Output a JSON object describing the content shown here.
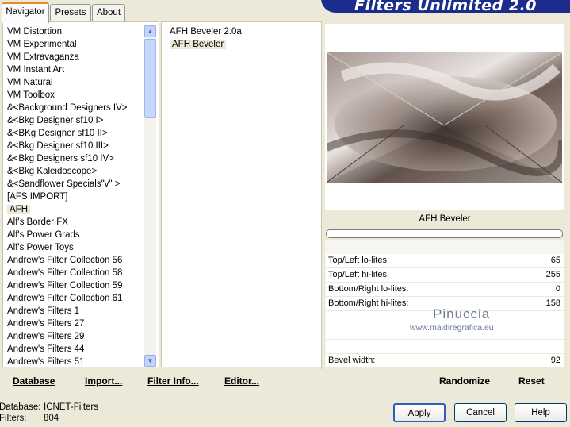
{
  "tabs": [
    {
      "label": "Navigator"
    },
    {
      "label": "Presets"
    },
    {
      "label": "About"
    }
  ],
  "banner": {
    "title": "Filters Unlimited 2.0"
  },
  "categories": [
    "VM Distortion",
    "VM Experimental",
    "VM Extravaganza",
    "VM Instant Art",
    "VM Natural",
    "VM Toolbox",
    "&<Background Designers IV>",
    "&<Bkg Designer sf10 I>",
    "&<BKg Designer sf10 II>",
    "&<Bkg Designer sf10 III>",
    "&<Bkg Designers sf10 IV>",
    "&<Bkg Kaleidoscope>",
    "&<Sandflower Specials\"v\" >",
    "[AFS IMPORT]",
    "AFH",
    "Alf's Border FX",
    "Alf's Power Grads",
    "Alf's Power Toys",
    "Andrew's Filter Collection 56",
    "Andrew's Filter Collection 58",
    "Andrew's Filter Collection 59",
    "Andrew's Filter Collection 61",
    "Andrew's Filters 1",
    "Andrew's Filters 27",
    "Andrew's Filters 29",
    "Andrew's Filters 44",
    "Andrew's Filters 51"
  ],
  "selected_category": "AFH",
  "filters": [
    "AFH Beveler 2.0a",
    "AFH Beveler"
  ],
  "selected_filter": "AFH Beveler",
  "bottom_buttons": {
    "database": "Database",
    "import": "Import...",
    "filter_info": "Filter Info...",
    "editor": "Editor..."
  },
  "filter_name": "AFH Beveler",
  "params": [
    {
      "label": "Top/Left lo-lites:",
      "value": "65"
    },
    {
      "label": "Top/Left hi-lites:",
      "value": "255"
    },
    {
      "label": "Bottom/Right lo-lites:",
      "value": "0"
    },
    {
      "label": "Bottom/Right hi-lites:",
      "value": "158"
    },
    {
      "label": "",
      "value": ""
    },
    {
      "label": "",
      "value": ""
    },
    {
      "label": "",
      "value": ""
    },
    {
      "label": "Bevel width:",
      "value": "92"
    }
  ],
  "randomize_label": "Randomize",
  "reset_label": "Reset",
  "watermark": {
    "title": "Pinuccia",
    "url": "www.maidiregrafica.eu"
  },
  "status": {
    "database_label": "Database:",
    "database_value": "ICNET-Filters",
    "filters_label": "Filters:",
    "filters_value": "804"
  },
  "dialog_buttons": {
    "apply": "Apply",
    "cancel": "Cancel",
    "help": "Help"
  }
}
